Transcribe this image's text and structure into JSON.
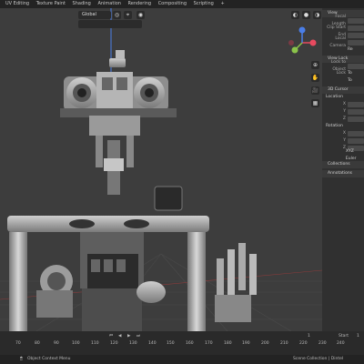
{
  "menubar": {
    "tabs": [
      "UV Editing",
      "Texture Paint",
      "Shading",
      "Animation",
      "Rendering",
      "Compositing",
      "Scripting",
      "+"
    ]
  },
  "viewport": {
    "orientation_label": "Global"
  },
  "sidebar": {
    "view_section": "View",
    "focal_length_label": "Focal Length",
    "clip_start_label": "Clip Start",
    "clip_end_label": "End",
    "local_camera_label": "Local Camera",
    "render_region_label": "Re",
    "view_lock_section": "View Lock",
    "lock_to_object_label": "Lock to Object",
    "lock_label": "Lock",
    "lock_option_1": "To",
    "lock_option_2": "To",
    "cursor_section": "3D Cursor",
    "location_label": "Location",
    "rotation_label": "Rotation",
    "x_label": "X",
    "y_label": "Y",
    "z_label": "Z",
    "rotation_mode": "XYZ Euler",
    "collections_section": "Collections",
    "annotations_section": "Annotations"
  },
  "timeline": {
    "ticks": [
      "70",
      "80",
      "90",
      "100",
      "110",
      "120",
      "130",
      "140",
      "150",
      "160",
      "170",
      "180",
      "190",
      "200",
      "210",
      "220",
      "230",
      "240"
    ],
    "current_frame": "1",
    "start_label": "Start",
    "start_value": "1"
  },
  "statusbar": {
    "left_text": "Object Context Menu",
    "right_text": "Scene Collection | Dintel"
  },
  "colors": {
    "background": "#3d3d3d",
    "x_axis": "#e84a5f",
    "y_axis": "#8bc34a",
    "z_axis": "#4a7ee8",
    "selection": "#2f67c7"
  }
}
